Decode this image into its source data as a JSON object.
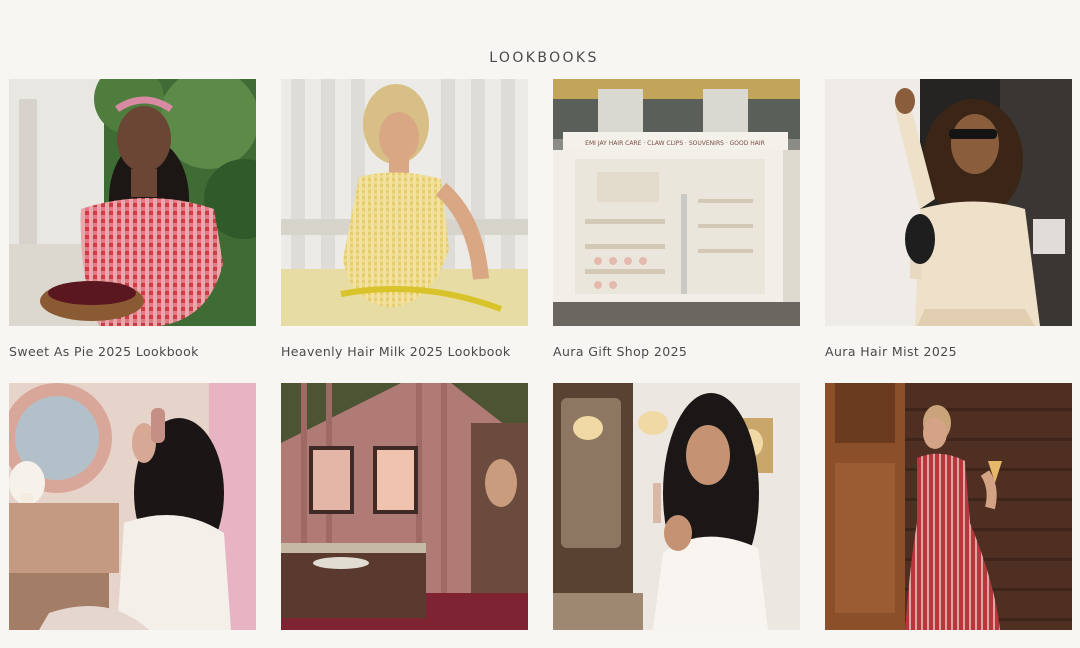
{
  "section": {
    "title": "LOOKBOOKS"
  },
  "lookbooks": [
    {
      "title": "Sweet As Pie 2025 Lookbook",
      "image_alt": "Woman in red gingham off-shoulder top holding a basket of cherries"
    },
    {
      "title": "Heavenly Hair Milk 2025 Lookbook",
      "image_alt": "Blonde woman in yellow gingham swimsuit lounging in a chair"
    },
    {
      "title": "Aura Gift Shop 2025",
      "image_alt": "White pop-up gift shop kiosk",
      "sign_text": "EMI JAY HAIR CARE · CLAW CLIPS · SOUVENIRS · GOOD HAIR"
    },
    {
      "title": "Aura Hair Mist 2025",
      "image_alt": "Woman with curly hair and sunglasses in a fringed cream jacket"
    },
    {
      "title": "",
      "image_alt": "Woman at vanity clipping her long dark hair"
    },
    {
      "title": "",
      "image_alt": "Pink draped room with framed art and a round display case"
    },
    {
      "title": "",
      "image_alt": "Woman applying serum with a dropper in a vintage bathroom"
    },
    {
      "title": "",
      "image_alt": "Woman in red striped dress holding an ice cream cone"
    }
  ]
}
